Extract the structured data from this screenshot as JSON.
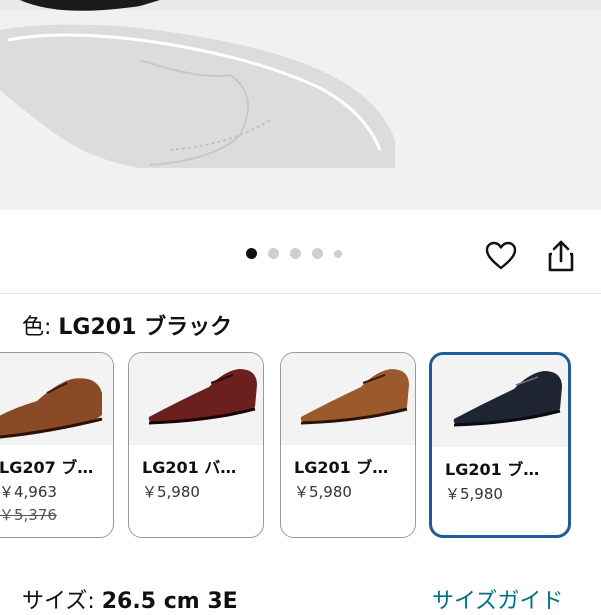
{
  "gallery": {
    "dots": 5,
    "active_index": 0
  },
  "actions": {
    "wishlist_icon": "heart-icon",
    "share_icon": "share-icon"
  },
  "color": {
    "label": "色: ",
    "value": "LG201 ブラック"
  },
  "swatches": [
    {
      "name": "LG207 ブ…",
      "price": "￥4,963",
      "list_price": "￥5,376",
      "shoe_color": "#8a4a26",
      "selected": false
    },
    {
      "name": "LG201 バ…",
      "price": "￥5,980",
      "shoe_color": "#6b1f1f",
      "selected": false
    },
    {
      "name": "LG201 ブ…",
      "price": "￥5,980",
      "shoe_color": "#9a5a2e",
      "selected": false
    },
    {
      "name": "LG201 ブ…",
      "price": "￥5,980",
      "shoe_color": "#1f2433",
      "selected": true
    }
  ],
  "size": {
    "label": "サイズ: ",
    "value": "26.5 cm 3E",
    "guide_link": "サイズガイド"
  },
  "colors": {
    "selected_border": "#1f5c99",
    "link": "#007185"
  }
}
